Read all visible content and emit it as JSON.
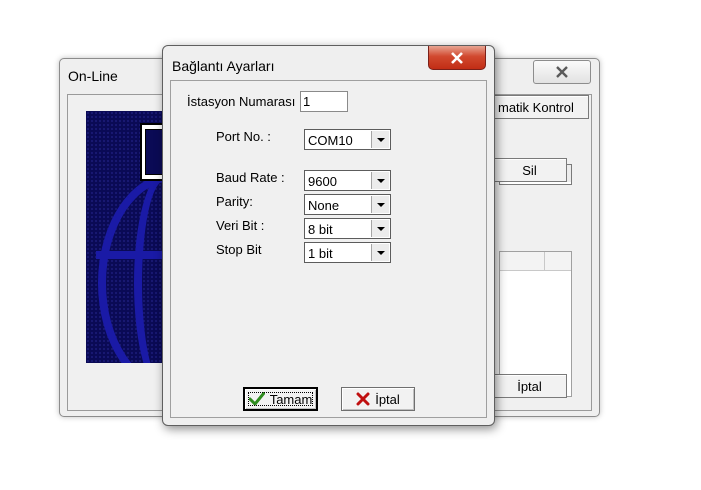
{
  "background_window": {
    "title": "On-Line",
    "buttons": {
      "auto_control_label": "matik Kontrol",
      "delete_label": "Sil",
      "cancel_label": "İptal"
    }
  },
  "dialog": {
    "title": "Bağlantı Ayarları",
    "fields": {
      "station_number": {
        "label": "İstasyon Numarası",
        "value": "1"
      },
      "port": {
        "label": "Port No. :",
        "value": "COM10"
      },
      "baud_rate": {
        "label": "Baud Rate :",
        "value": "9600"
      },
      "parity": {
        "label": "Parity:",
        "value": "None"
      },
      "data_bits": {
        "label": "Veri Bit :",
        "value": "8 bit"
      },
      "stop_bits": {
        "label": "Stop Bit",
        "value": "1 bit"
      }
    },
    "buttons": {
      "ok_label": "Tamam",
      "cancel_label": "İptal"
    }
  },
  "icons": {
    "close": "close-x-icon",
    "dropdown": "chevron-down-icon",
    "ok": "green-checkmark-icon",
    "cancel": "red-x-icon"
  },
  "colors": {
    "close_button_red": "#c94a31",
    "ok_check_green": "#2e8b1e",
    "cancel_x_red": "#c01010",
    "panel_navy": "#0a0a55",
    "globe_blue": "#1a1aa6"
  }
}
